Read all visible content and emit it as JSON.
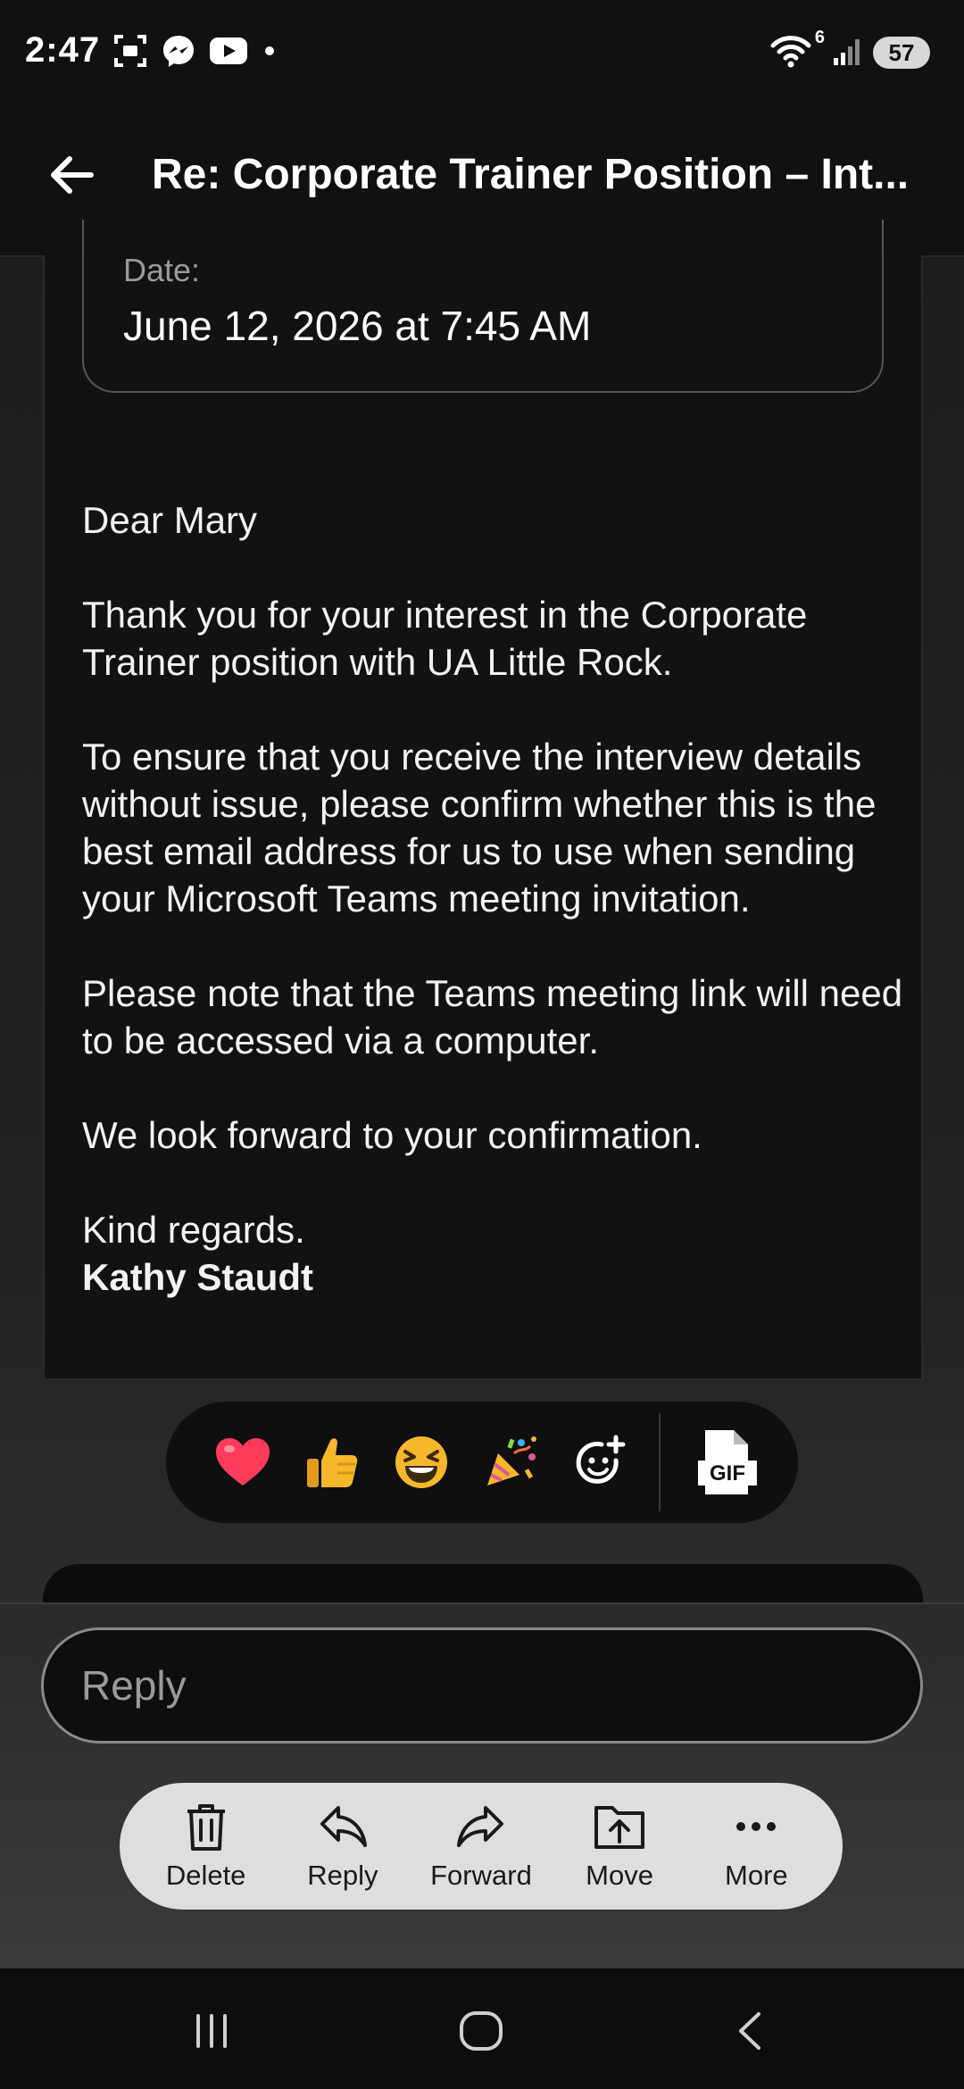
{
  "status_bar": {
    "time": "2:47",
    "wifi_badge": "6",
    "battery": "57",
    "left_icons": [
      "screenshot-icon",
      "messenger-icon",
      "youtube-icon",
      "notification-dot-icon"
    ],
    "right_icons": [
      "wifi-icon",
      "signal-icon",
      "battery-icon"
    ]
  },
  "header": {
    "back_icon": "arrow-left-icon",
    "subject": "Re: Corporate Trainer Position – Int..."
  },
  "message": {
    "date_label": "Date:",
    "date_value": "June 12, 2026 at 7:45 AM",
    "greeting": "Dear Mary",
    "paragraph_1": "Thank you for your interest in the Corporate Trainer position with UA Little Rock.",
    "paragraph_2": "To ensure that you receive the interview details without issue, please confirm whether this is the best email address for us to use when sending your Microsoft Teams meeting invitation.",
    "paragraph_3": "Please note that the Teams meeting link will need to be accessed via a computer.",
    "paragraph_4": "We look forward to your confirmation.",
    "closing": "Kind regards.",
    "signature": "Kathy Staudt"
  },
  "reactions": {
    "items": [
      "heart-icon",
      "thumbs-up-icon",
      "laughing-face-icon",
      "party-popper-icon",
      "add-reaction-icon"
    ],
    "gif_icon": "gif-icon",
    "gif_text": "GIF"
  },
  "reply": {
    "placeholder": "Reply"
  },
  "actions": {
    "delete": "Delete",
    "reply": "Reply",
    "forward": "Forward",
    "move": "Move",
    "more": "More"
  },
  "nav": {
    "recents_icon": "recents-icon",
    "home_icon": "home-icon",
    "back_icon": "back-chevron-icon"
  },
  "colors": {
    "heart": "#ff3b5c",
    "emoji_yellow": "#f6b72a",
    "action_pill": "#dedede"
  }
}
